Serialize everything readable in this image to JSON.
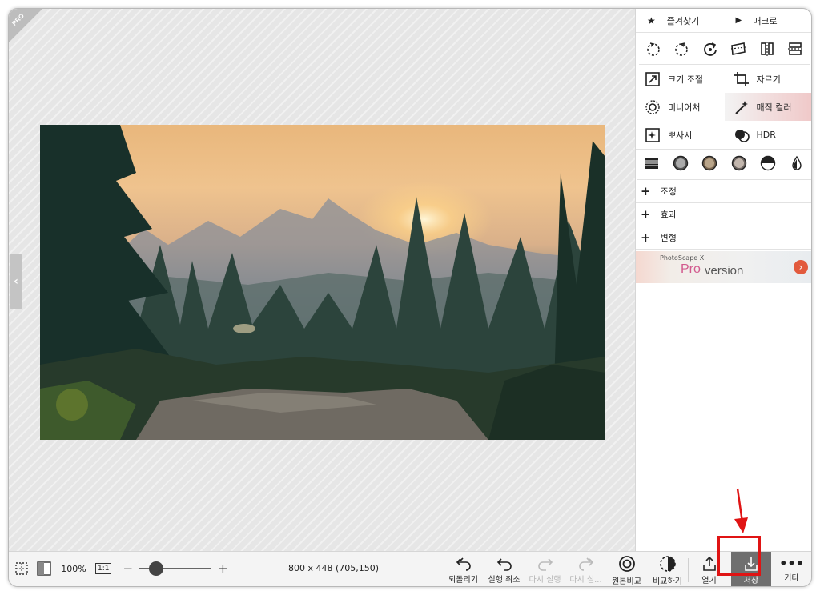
{
  "sidebar": {
    "top": [
      {
        "icon": "star-icon",
        "label": "즐겨찾기"
      },
      {
        "icon": "play-icon",
        "label": "매크로"
      }
    ],
    "rotate_icons": [
      "rotate-left-icon",
      "rotate-right-icon",
      "rotate-free-icon",
      "straighten-icon",
      "flip-horizontal-icon",
      "flip-vertical-icon"
    ],
    "tools": [
      {
        "icon": "resize-icon",
        "label": "크기 조절"
      },
      {
        "icon": "crop-icon",
        "label": "자르기"
      },
      {
        "icon": "miniature-icon",
        "label": "미니어처"
      },
      {
        "icon": "magic-wand-icon",
        "label": "매직 컬러"
      },
      {
        "icon": "sparkle-icon",
        "label": "뽀사시"
      },
      {
        "icon": "hdr-icon",
        "label": "HDR"
      }
    ],
    "filter_icons": [
      "levels-icon",
      "filter-gray-icon",
      "filter-sepia-icon",
      "filter-warm-icon",
      "filter-halftone-icon",
      "drop-icon"
    ],
    "sections": [
      "조정",
      "효과",
      "변형"
    ],
    "ad": {
      "brand": "PhotoScape X",
      "pro": "Pro",
      "version": "version"
    }
  },
  "canvas": {
    "pro_badge": "PRO"
  },
  "bottombar": {
    "zoom": "100%",
    "one_to_one": "1:1",
    "minus": "−",
    "plus": "+",
    "zoom_level": 0.18,
    "dimensions": "800 x 448 (705,150)",
    "buttons": [
      {
        "label": "되돌리기",
        "icon": "revert-icon",
        "enabled": true
      },
      {
        "label": "실행 취소",
        "icon": "undo-icon",
        "enabled": true
      },
      {
        "label": "다시 실행",
        "icon": "redo-icon",
        "enabled": false
      },
      {
        "label": "다시 실...",
        "icon": "redo-all-icon",
        "enabled": false
      },
      {
        "label": "원본비교",
        "icon": "compare-original-icon",
        "enabled": true
      },
      {
        "label": "비교하기",
        "icon": "compare-icon",
        "enabled": true
      },
      {
        "label": "열기",
        "icon": "share-icon",
        "enabled": true
      },
      {
        "label": "저장",
        "icon": "save-icon",
        "enabled": true
      },
      {
        "label": "기타",
        "icon": "more-icon",
        "enabled": true
      }
    ]
  },
  "colors": {
    "highlight": "#f0c8c8",
    "save_bg": "#6f6f6f",
    "annotation": "#e01414"
  }
}
